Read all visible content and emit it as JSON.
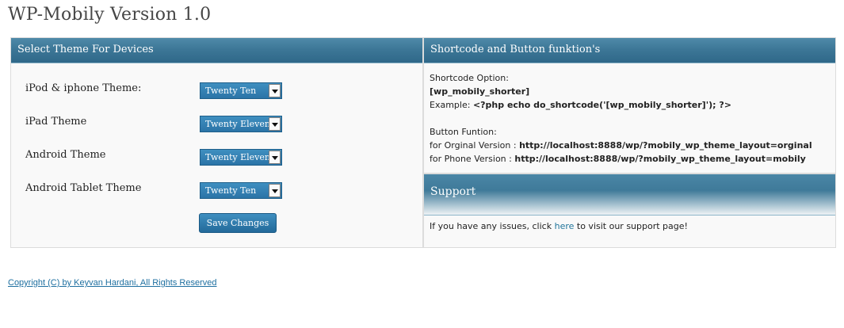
{
  "page_title": "WP-Mobily Version 1.0",
  "theme_panel": {
    "header": "Select Theme For Devices",
    "rows": [
      {
        "label": "iPod & iphone Theme:",
        "value": "Twenty Ten"
      },
      {
        "label": "iPad Theme",
        "value": "Twenty Eleven"
      },
      {
        "label": "Android Theme",
        "value": "Twenty Eleven"
      },
      {
        "label": "Android Tablet Theme",
        "value": "Twenty Ten"
      }
    ],
    "save_label": "Save Changes"
  },
  "shortcode_panel": {
    "header": "Shortcode and Button funktion's",
    "option_label": "Shortcode Option:",
    "shortcode": "[wp_mobily_shorter]",
    "example_prefix": "Example:",
    "example_code": "<?php echo do_shortcode('[wp_mobily_shorter]'); ?>",
    "button_label": "Button Funtion:",
    "original_prefix": "for Orginal Version :",
    "original_url": "http://localhost:8888/wp/?mobily_wp_theme_layout=orginal",
    "phone_prefix": "for Phone Version :",
    "phone_url": "http://localhost:8888/wp/?mobily_wp_theme_layout=mobily"
  },
  "support_panel": {
    "header": "Support",
    "text_before": "If you have any issues, click",
    "link_text": "here",
    "text_after": "to visit our support page!"
  },
  "footer": {
    "copyright": "Copyright (C) by Keyvan Hardani, All Rights Reserved"
  },
  "colors": {
    "header_blue": "#3d7797",
    "select_blue": "#2b74a7",
    "link_blue": "#21759b"
  }
}
